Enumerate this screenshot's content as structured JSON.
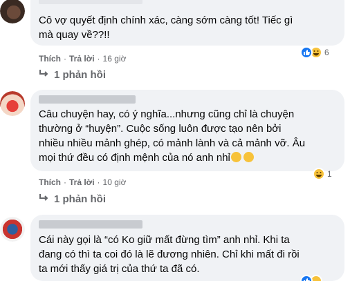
{
  "comments": [
    {
      "text_lines": [
        "Cô vợ quyết định chính xác, càng sớm càng tốt! Tiếc gì",
        "mà quay về??!!"
      ],
      "reaction_count": "6",
      "reaction_icons": [
        "like-icon",
        "haha-icon"
      ],
      "actions": {
        "like": "Thích",
        "reply": "Trả lời",
        "time": "16 giờ"
      },
      "replies": "1 phản hồi"
    },
    {
      "text_lines": [
        "Câu chuyện hay, có ý nghĩa...nhưng cũng chỉ là chuyện",
        "thường ở “huyện”. Cuộc sống luôn được tạo nên bởi",
        "nhiều nhiều mảnh ghép, có mảnh lành và cả mảnh vỡ. Âu",
        "mọi thứ đều có định mệnh của nó anh nhỉ"
      ],
      "reaction_count": "1",
      "reaction_icons": [
        "haha-icon"
      ],
      "actions": {
        "like": "Thích",
        "reply": "Trả lời",
        "time": "10 giờ"
      },
      "replies": "1 phản hồi"
    },
    {
      "text_lines": [
        "Cái này gọi là “có Ko giữ mất đừng tìm” anh nhỉ. Khi ta",
        "đang có thì ta coi đó là lẽ đương nhiên. Chỉ khi mất đi rồi",
        "ta mới thấy giá trị của thứ ta đã có."
      ],
      "reaction_icons": [
        "like-icon",
        "haha-icon"
      ]
    }
  ],
  "colors": {
    "bubble": "#f0f2f5",
    "meta_text": "#65676b",
    "like_blue": "#1877f2",
    "haha_yellow": "#f7c23a"
  }
}
